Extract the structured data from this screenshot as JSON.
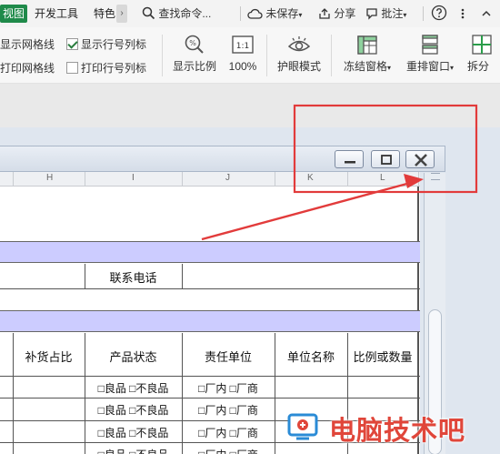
{
  "tabs": {
    "view": "视图",
    "developer": "开发工具",
    "special": "特色"
  },
  "toolbar": {
    "search": "查找命令...",
    "unsaved": "未保存",
    "share": "分享",
    "annotate": "批注",
    "help_icon": "help-icon",
    "collapse_icon": "chevron-up-icon"
  },
  "ribbon": {
    "show_gridlines": {
      "label": "显示网格线",
      "checked": false
    },
    "show_headers": {
      "label": "显示行号列标",
      "checked": true
    },
    "print_gridlines": {
      "label": "打印网格线",
      "checked": false
    },
    "print_headers": {
      "label": "打印行号列标",
      "checked": false
    },
    "zoom_ratio": "显示比例",
    "zoom_100_icon": "1:1",
    "zoom_100": "100%",
    "eye_protection": "护眼模式",
    "freeze_panes": "冻结窗格",
    "rearrange_windows": "重排窗口",
    "split_window": "拆分"
  },
  "window": {
    "controls": [
      "minimize-icon",
      "restore-icon",
      "close-icon"
    ]
  },
  "columns": [
    "H",
    "I",
    "J",
    "K",
    "L"
  ],
  "sheet": {
    "contact_phone": "联系电话",
    "headers": [
      "补货占比",
      "产品状态",
      "责任单位",
      "单位名称",
      "比例或数量"
    ],
    "status_options": "□良品 □不良品",
    "unit_options": "□厂内 □厂商"
  },
  "watermark": {
    "text": "电脑技术吧",
    "color": "#e0463a"
  },
  "colors": {
    "active_tab": "#1f8a4a",
    "band": "#ccccff",
    "annotation": "#e23b3b"
  }
}
